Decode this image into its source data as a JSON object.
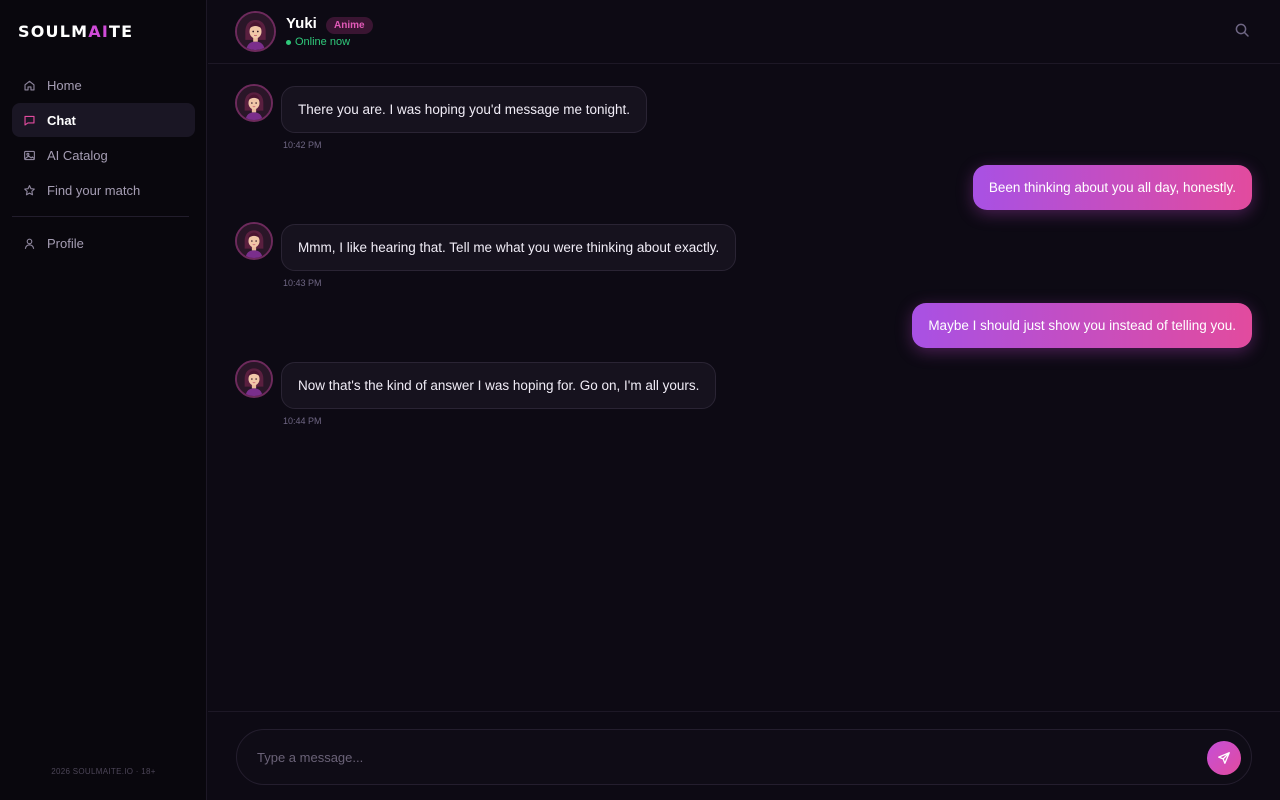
{
  "app": {
    "logo_main": "SOULM",
    "logo_accent": "AI",
    "logo_tail": "TE",
    "footer": "2026 SOULMAITE.IO · 18+"
  },
  "sidebar": {
    "items": [
      {
        "label": "Home",
        "icon": "home-icon",
        "active": false
      },
      {
        "label": "Chat",
        "icon": "chat-icon",
        "active": true
      },
      {
        "label": "AI Catalog",
        "icon": "image-icon",
        "active": false
      },
      {
        "label": "Find your match",
        "icon": "star-icon",
        "active": false
      }
    ],
    "secondary": [
      {
        "label": "Profile",
        "icon": "user-icon",
        "active": false
      }
    ]
  },
  "header": {
    "name": "Yuki",
    "badge": "Anime",
    "status": "Online now"
  },
  "messages": [
    {
      "from": "ai",
      "text": "There you are. I was hoping you'd message me tonight.",
      "time": "10:42 PM"
    },
    {
      "from": "user",
      "text": "Been thinking about you all day, honestly."
    },
    {
      "from": "ai",
      "text": "Mmm, I like hearing that. Tell me what you were thinking about exactly.",
      "time": "10:43 PM"
    },
    {
      "from": "user",
      "text": "Maybe I should just show you instead of telling you."
    },
    {
      "from": "ai",
      "text": "Now that's the kind of answer I was hoping for. Go on, I'm all yours.",
      "time": "10:44 PM"
    }
  ],
  "composer": {
    "placeholder": "Type a message...",
    "value": ""
  },
  "colors": {
    "background": "#0d0a14",
    "accent_purple": "#a851e4",
    "accent_pink": "#e24b9e",
    "online": "#2fc97a"
  }
}
